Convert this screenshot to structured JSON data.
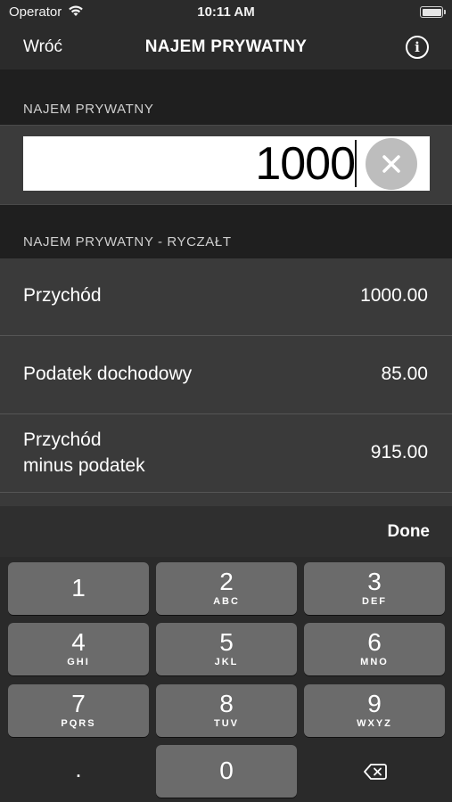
{
  "status_bar": {
    "carrier": "Operator",
    "time": "10:11 AM"
  },
  "nav": {
    "back_label": "Wróć",
    "title": "NAJEM PRYWATNY",
    "info_icon": "i"
  },
  "input_section": {
    "header": "NAJEM PRYWATNY",
    "amount": "1000"
  },
  "results_section": {
    "header": "NAJEM PRYWATNY - RYCZAŁT",
    "rows": [
      {
        "label": "Przychód",
        "value": "1000.00"
      },
      {
        "label": "Podatek dochodowy",
        "value": "85.00"
      },
      {
        "label_line1": "Przychód",
        "label_line2": "minus podatek",
        "value": "915.00"
      }
    ]
  },
  "toolbar": {
    "done_label": "Done"
  },
  "keypad": {
    "keys": [
      {
        "digit": "1",
        "letters": ""
      },
      {
        "digit": "2",
        "letters": "ABC"
      },
      {
        "digit": "3",
        "letters": "DEF"
      },
      {
        "digit": "4",
        "letters": "GHI"
      },
      {
        "digit": "5",
        "letters": "JKL"
      },
      {
        "digit": "6",
        "letters": "MNO"
      },
      {
        "digit": "7",
        "letters": "PQRS"
      },
      {
        "digit": "8",
        "letters": "TUV"
      },
      {
        "digit": "9",
        "letters": "WXYZ"
      },
      {
        "digit": "0",
        "letters": ""
      }
    ],
    "decimal": "."
  }
}
